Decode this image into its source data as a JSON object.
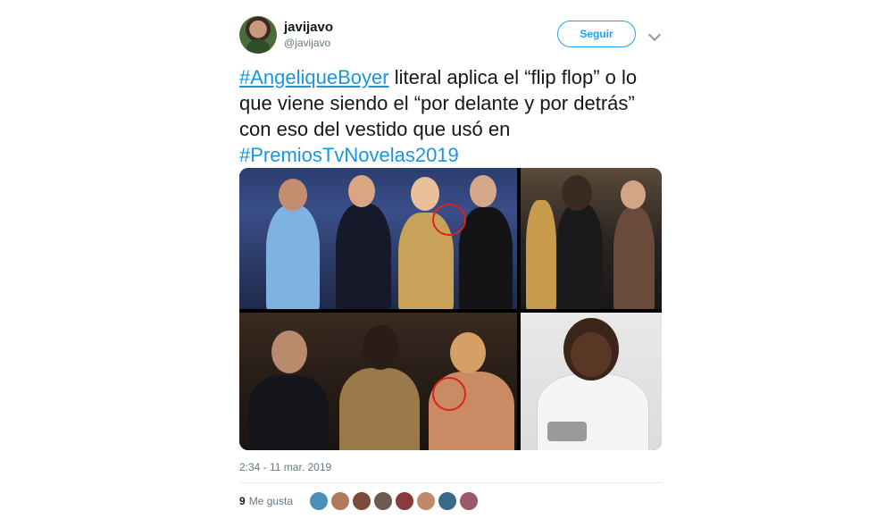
{
  "tweet": {
    "display_name": "javijavo",
    "handle": "@javijavo",
    "follow_label": "Seguir",
    "text_parts": {
      "hashtag1": "#AngeliqueBoyer",
      "body": " literal aplica el “flip flop” o lo que viene siendo el “por delante y por detrás” con eso del vestido que usó en ",
      "hashtag2": "#PremiosTvNovelas2019"
    },
    "timestamp": "2:34 - 11 mar. 2019",
    "likes_count": "9",
    "likes_label": "Me gusta"
  },
  "icons": {
    "more": "chevron-down-icon"
  },
  "colors": {
    "accent": "#1da1f2",
    "hashtag": "#1b95e0",
    "muted": "#657786",
    "highlight_circle": "#e0221a"
  }
}
